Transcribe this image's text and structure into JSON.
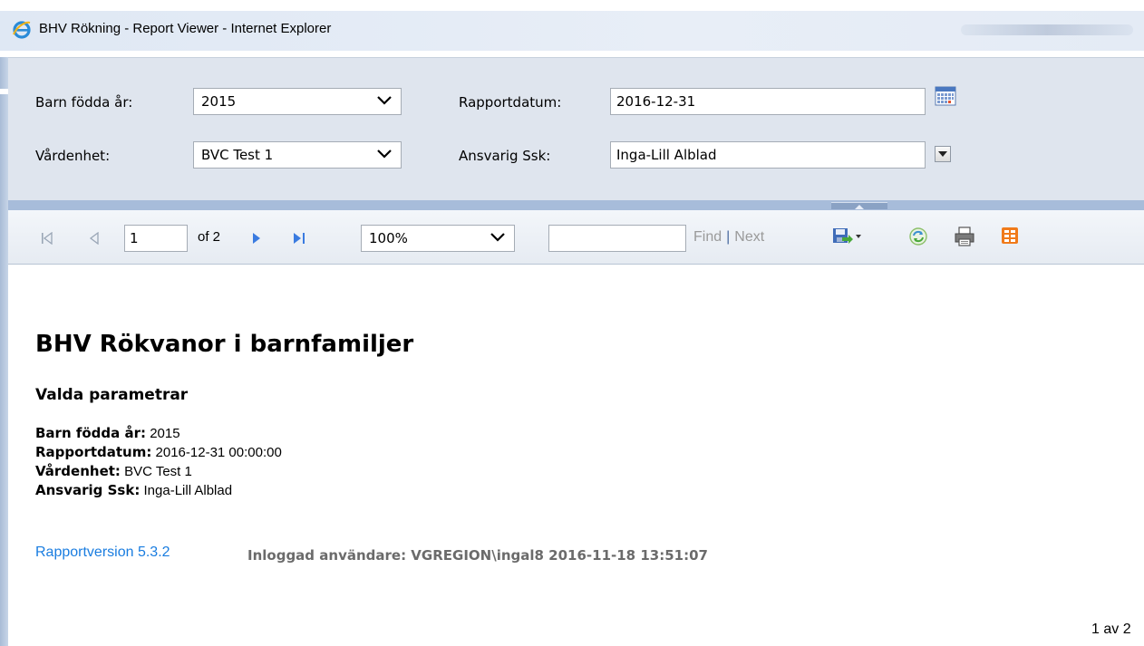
{
  "window": {
    "title": "BHV Rökning - Report Viewer - Internet Explorer",
    "icon": "internet-explorer-icon"
  },
  "parameters": {
    "birth_year_label": "Barn födda år:",
    "birth_year_value": "2015",
    "report_date_label": "Rapportdatum:",
    "report_date_value": "2016-12-31",
    "unit_label": "Vårdenhet:",
    "unit_value": "BVC Test 1",
    "nurse_label": "Ansvarig Ssk:",
    "nurse_value": "Inga-Lill Alblad"
  },
  "toolbar": {
    "current_page": "1",
    "of_pages": "of 2",
    "zoom": "100%",
    "find_value": "",
    "find_label": "Find",
    "separator": "|",
    "next_label": "Next",
    "icons": [
      "first-page-icon",
      "previous-page-icon",
      "next-page-icon",
      "last-page-icon",
      "export-icon",
      "refresh-icon",
      "print-icon",
      "data-feed-icon"
    ]
  },
  "report": {
    "title": "BHV Rökvanor i barnfamiljer",
    "subtitle": "Valda parametrar",
    "params": [
      {
        "label": "Barn födda år:",
        "value": "2015"
      },
      {
        "label": "Rapportdatum:",
        "value": "2016-12-31 00:00:00"
      },
      {
        "label": "Vårdenhet:",
        "value": "BVC Test 1"
      },
      {
        "label": "Ansvarig Ssk:",
        "value": "Inga-Lill Alblad"
      }
    ],
    "version": "Rapportversion 5.3.2",
    "logged_in_user": "Inloggad användare: VGREGION\\ingal8 2016-11-18 13:51:07",
    "page_indicator": "1 av 2"
  },
  "colors": {
    "param_background": "#dfe5ee",
    "splitter": "#a7bcda",
    "link_blue": "#1a7de0"
  }
}
